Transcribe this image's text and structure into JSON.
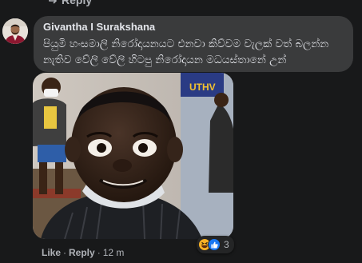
{
  "top_reply": {
    "label": "Reply",
    "icon": "reply-arrow-icon"
  },
  "comment": {
    "author": "Givantha I Surakshana",
    "text": "පියුමි හංසමාලි නිරෝදායනයට එනවා කිව්වම වැලක් වත් බලන්න\nනැතිව වේලි වේලි හිටපු නිරෝදායන මධයස්තානේ උන්",
    "avatar_icon": "user-avatar",
    "photo_icon": "meme-photo",
    "reactions": {
      "icons": [
        "haha-emoji-icon",
        "like-thumb-icon"
      ],
      "count": "3"
    },
    "actions": {
      "like": "Like",
      "separator": "·",
      "reply": "Reply",
      "time": "12 m"
    }
  },
  "colors": {
    "background": "#18191a",
    "bubble": "#3a3b3c",
    "text_primary": "#e4e6eb",
    "text_secondary": "#b0b3b8",
    "like_blue": "#1877f2",
    "haha_yellow": "#f7b125"
  }
}
